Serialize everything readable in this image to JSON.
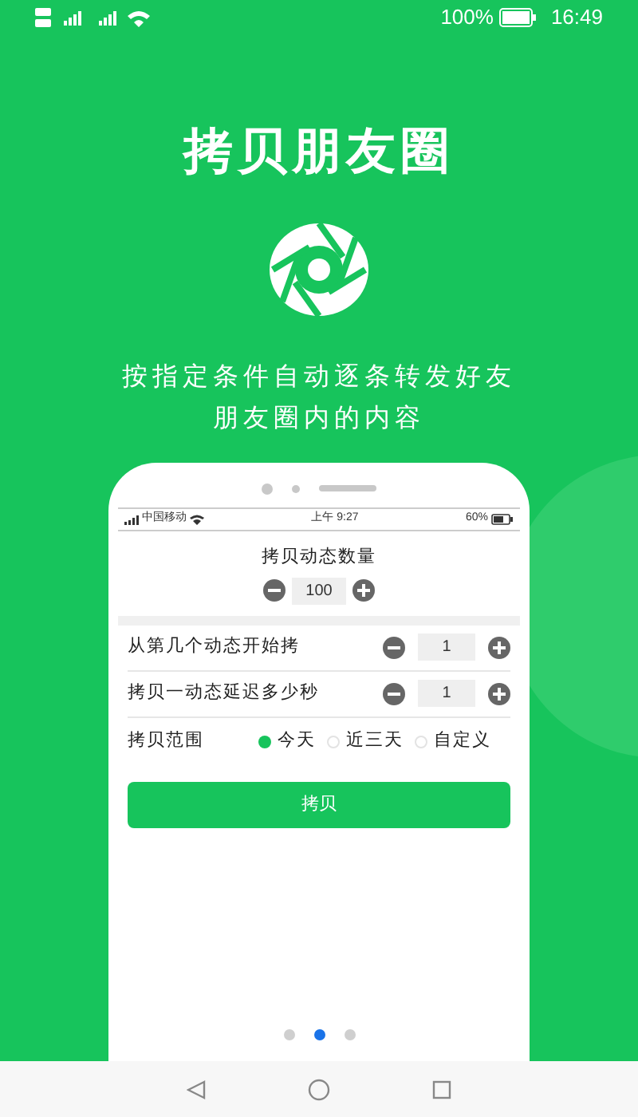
{
  "status_bar": {
    "battery": "100%",
    "time": "16:49"
  },
  "hero": {
    "title": "拷贝朋友圈",
    "subtitle_lines": [
      "按指定条件自动逐条转发好友",
      "朋友圈内的内容"
    ]
  },
  "phone": {
    "status_bar": {
      "carrier": "中国移动",
      "time": "上午 9:27",
      "battery": "60%"
    },
    "quantity": {
      "label": "拷贝动态数量",
      "value": "100"
    },
    "rows": [
      {
        "label": "从第几个动态开始拷",
        "value": "1"
      },
      {
        "label": "拷贝一动态延迟多少秒",
        "value": "1"
      }
    ],
    "range": {
      "label": "拷贝范围",
      "options": [
        {
          "label": "今天",
          "selected": true
        },
        {
          "label": "近三天",
          "selected": false
        },
        {
          "label": "自定义",
          "selected": false
        }
      ]
    },
    "button": "拷贝"
  },
  "pager": [
    {
      "selected": false
    },
    {
      "selected": true
    },
    {
      "selected": false
    }
  ]
}
